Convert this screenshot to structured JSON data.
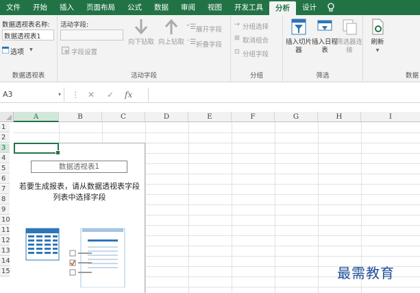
{
  "ribbon_tabs": [
    "文件",
    "开始",
    "插入",
    "页面布局",
    "公式",
    "数据",
    "审阅",
    "视图",
    "开发工具",
    "分析",
    "设计"
  ],
  "active_tab": "分析",
  "tell_me_icon": "lightbulb-icon",
  "pivot_group": {
    "name_label": "数据透视表名称:",
    "name_value": "数据透视表1",
    "options_label": "选项",
    "group_label": "数据透视表"
  },
  "active_field_group": {
    "field_label": "活动字段:",
    "field_settings": "字段设置",
    "drill_down": "向下钻取",
    "drill_up": "向上钻取",
    "expand_field": "展开字段",
    "collapse_field": "折叠字段",
    "group_label": "活动字段"
  },
  "group_group": {
    "group_selection": "分组选择",
    "ungroup": "取消组合",
    "group_field": "分组字段",
    "group_label": "分组"
  },
  "filter_group": {
    "insert_slicer": "插入切片器",
    "insert_timeline": "插入日程表",
    "filter_connections": "筛选器连接",
    "group_label": "筛选"
  },
  "data_group": {
    "refresh": "刷新",
    "group_label": "数据"
  },
  "formula_bar": {
    "name_box": "A3",
    "fx": "fx"
  },
  "columns": [
    "A",
    "B",
    "C",
    "D",
    "E",
    "F",
    "G",
    "H",
    "I"
  ],
  "rows": [
    "1",
    "2",
    "3",
    "4",
    "5",
    "6",
    "7",
    "8",
    "9",
    "10",
    "11",
    "12",
    "13",
    "14",
    "15"
  ],
  "pivot_placeholder": {
    "title": "数据透视表1",
    "message": "若要生成报表，请从数据透视表字段列表中选择字段"
  },
  "watermark": "最需教育",
  "colors": {
    "excel_green": "#217346",
    "ribbon_bg": "#f3f3f3",
    "icon_blue": "#2e75b6"
  }
}
